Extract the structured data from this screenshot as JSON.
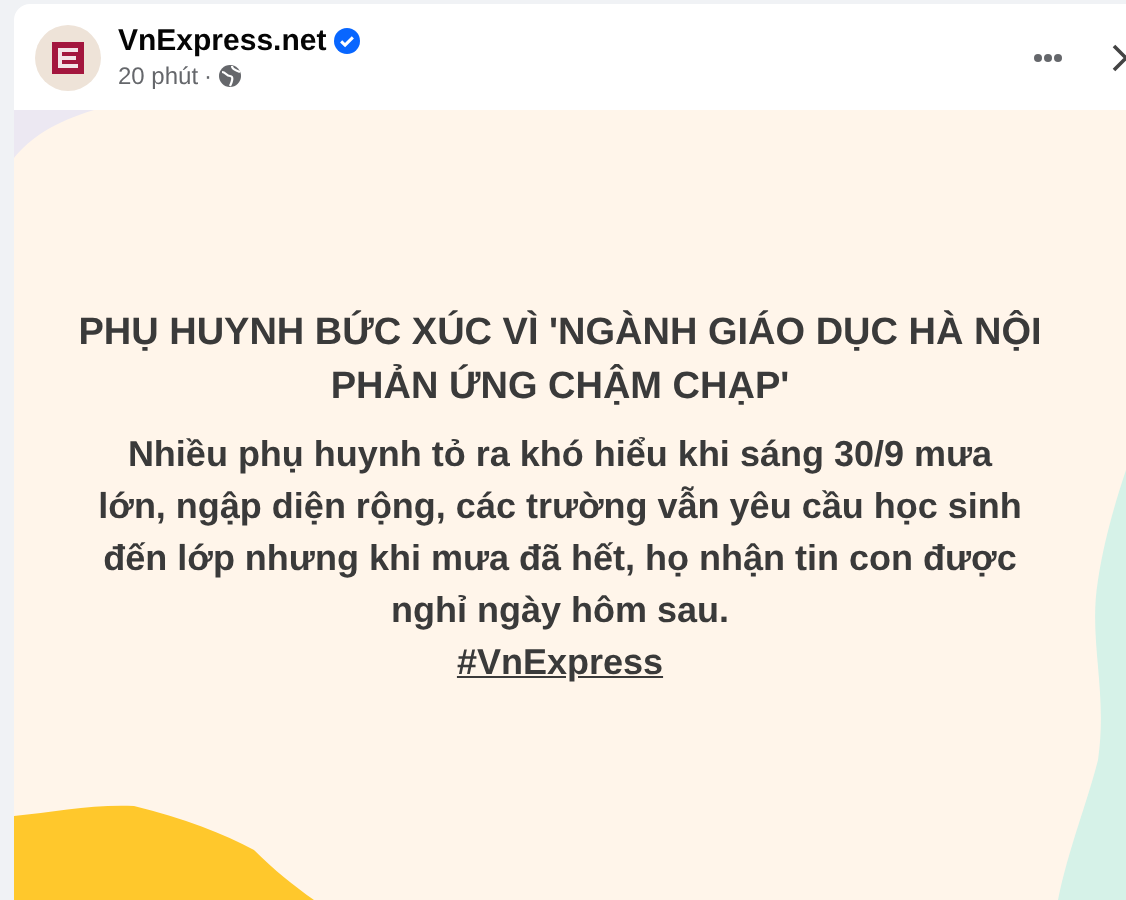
{
  "post": {
    "author": "VnExpress.net",
    "verified": true,
    "time": "20 phút",
    "separator": "·",
    "headline": "PHỤ HUYNH BỨC XÚC VÌ 'NGÀNH GIÁO DỤC HÀ NỘI PHẢN ỨNG CHẬM CHẠP'",
    "body": "Nhiều phụ huynh tỏ ra khó hiểu khi sáng 30/9 mưa lớn, ngập diện rộng, các trường vẫn yêu cầu học sinh đến lớp nhưng khi mưa đã hết, họ nhận tin con được nghỉ ngày hôm sau.",
    "hashtag": "#VnExpress"
  }
}
